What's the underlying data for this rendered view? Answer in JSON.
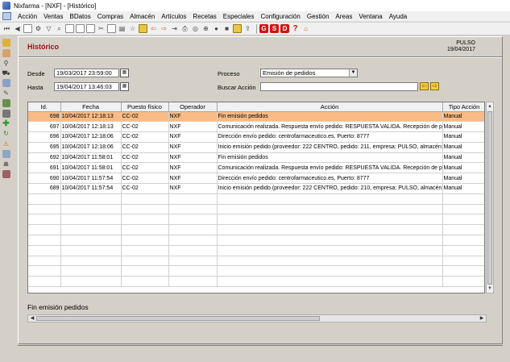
{
  "window": {
    "title": "Nixfarma - [NXF] - [Histórico]"
  },
  "menu": [
    "Acción",
    "Ventas",
    "BDatos",
    "Compras",
    "Almacén",
    "Artículos",
    "Recetas",
    "Especiales",
    "Configuración",
    "Gestión",
    "Areas",
    "Ventana",
    "Ayuda"
  ],
  "toolbar": {
    "g": "G",
    "s": "S",
    "d": "D",
    "help": "?"
  },
  "header": {
    "title": "Histórico",
    "company": "PULSO",
    "date": "19/04/2017"
  },
  "filters": {
    "desde_label": "Desde",
    "desde_value": "19/03/2017 23:59:00",
    "hasta_label": "Hasta",
    "hasta_value": "19/04/2017 13:46:03",
    "proceso_label": "Proceso",
    "proceso_value": "Emisión de pedidos",
    "buscar_label": "Buscar Acción",
    "buscar_value": ""
  },
  "table": {
    "columns": [
      "Id.",
      "Fecha",
      "Puesto físico",
      "Operador",
      "Acción",
      "Tipo Acción"
    ],
    "rows": [
      {
        "id": "698",
        "fecha": "10/04/2017 12:18:13",
        "puesto": "CC-02",
        "operador": "NXF",
        "accion": "Fin emisión pedidos",
        "tipo": "Manual"
      },
      {
        "id": "697",
        "fecha": "10/04/2017 12:18:13",
        "puesto": "CC-02",
        "operador": "NXF",
        "accion": "Comunicación realizada. Respuesta envío pedido: RESPUESTA VALIDA. Recepción de p",
        "tipo": "Manual"
      },
      {
        "id": "696",
        "fecha": "10/04/2017 12:18:06",
        "puesto": "CC-02",
        "operador": "NXF",
        "accion": "Dirección envío pedido: centrofarmaceutico.es, Puerto: 8777",
        "tipo": "Manual"
      },
      {
        "id": "695",
        "fecha": "10/04/2017 12:18:06",
        "puesto": "CC-02",
        "operador": "NXF",
        "accion": "Inicio emisión pedido (proveedor: 222 CENTRO, pedido: 211, empresa: PULSO, almacén: P",
        "tipo": "Manual"
      },
      {
        "id": "692",
        "fecha": "10/04/2017 11:58:01",
        "puesto": "CC-02",
        "operador": "NXF",
        "accion": "Fin emisión pedidos",
        "tipo": "Manual"
      },
      {
        "id": "691",
        "fecha": "10/04/2017 11:58:01",
        "puesto": "CC-02",
        "operador": "NXF",
        "accion": "Comunicación realizada. Respuesta envío pedido: RESPUESTA VALIDA. Recepción de p",
        "tipo": "Manual"
      },
      {
        "id": "690",
        "fecha": "10/04/2017 11:57:54",
        "puesto": "CC-02",
        "operador": "NXF",
        "accion": "Dirección envío pedido: centrofarmaceutico.es, Puerto: 8777",
        "tipo": "Manual"
      },
      {
        "id": "689",
        "fecha": "10/04/2017 11:57:54",
        "puesto": "CC-02",
        "operador": "NXF",
        "accion": "Inicio emisión pedido (proveedor: 222 CENTRO, pedido: 210, empresa: PULSO, almacén: P",
        "tipo": "Manual"
      }
    ],
    "empty_rows": 9
  },
  "detail": {
    "text": "Fin emisión pedidos"
  },
  "colors": {
    "title_red": "#9c1010",
    "selected_row": "#f9bb85"
  }
}
